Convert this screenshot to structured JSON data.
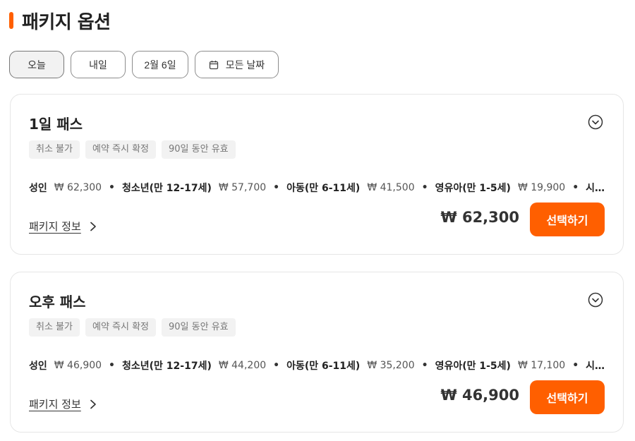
{
  "section": {
    "title": "패키지 옵션",
    "accent_color": "#ff5f00"
  },
  "dates": [
    {
      "label": "오늘",
      "selected": true
    },
    {
      "label": "내일",
      "selected": false
    },
    {
      "label": "2월 6일",
      "selected": false
    },
    {
      "label": "모든 날짜",
      "selected": false,
      "icon": "calendar-icon"
    }
  ],
  "packages": [
    {
      "title": "1일 패스",
      "tags": [
        "취소 불가",
        "예약 즉시 확정",
        "90일 동안 유효"
      ],
      "prices": [
        {
          "label": "성인",
          "value": "₩ 62,300"
        },
        {
          "label": "청소년(만 12-17세)",
          "value": "₩ 57,700"
        },
        {
          "label": "아동(만 6-11세)",
          "value": "₩ 41,500"
        },
        {
          "label": "영유아(만 1-5세)",
          "value": "₩ 19,900"
        }
      ],
      "more": "시…",
      "link": "패키지 정보",
      "price": "₩ 62,300",
      "button": "선택하기"
    },
    {
      "title": "오후 패스",
      "tags": [
        "취소 불가",
        "예약 즉시 확정",
        "90일 동안 유효"
      ],
      "prices": [
        {
          "label": "성인",
          "value": "₩ 46,900"
        },
        {
          "label": "청소년(만 12-17세)",
          "value": "₩ 44,200"
        },
        {
          "label": "아동(만 6-11세)",
          "value": "₩ 35,200"
        },
        {
          "label": "영유아(만 1-5세)",
          "value": "₩ 17,100"
        }
      ],
      "more": "시…",
      "link": "패키지 정보",
      "price": "₩ 46,900",
      "button": "선택하기"
    }
  ]
}
